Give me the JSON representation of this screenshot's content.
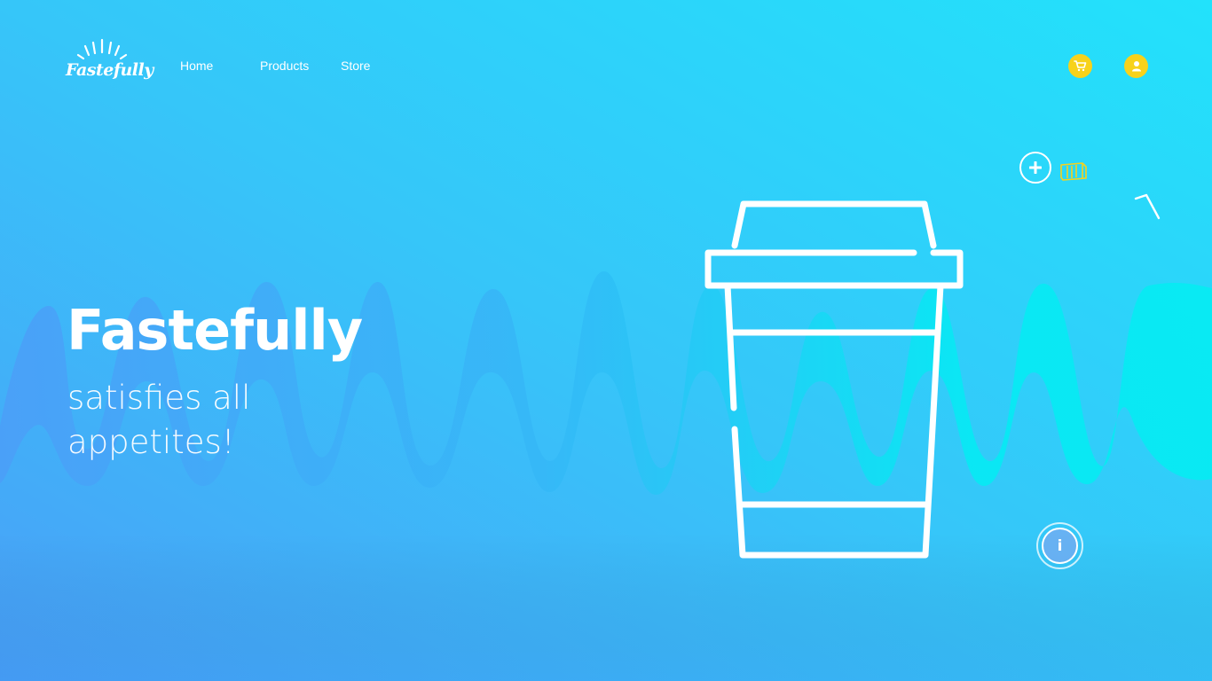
{
  "brand": {
    "name": "Fastefully"
  },
  "nav": {
    "items": [
      {
        "label": "Home"
      },
      {
        "label": "Products"
      },
      {
        "label": "Store"
      }
    ]
  },
  "header_actions": {
    "cart_icon": "cart-icon",
    "user_icon": "user-icon",
    "accent_color": "#f7d21b"
  },
  "hero": {
    "title": "Fastefully",
    "subtitle_line1": "satisfies all",
    "subtitle_line2": "appetites!"
  },
  "floating_controls": {
    "add_icon": "plus-icon",
    "ticket_icon": "ticket-icon",
    "info_label": "i"
  },
  "illustration": {
    "icon": "coffee-cup-icon"
  },
  "colors": {
    "background_start": "#45a3f7",
    "background_end": "#13eef5",
    "wave_start": "#4d9ff8",
    "wave_end": "#05f0f0",
    "accent": "#f7d21b"
  }
}
